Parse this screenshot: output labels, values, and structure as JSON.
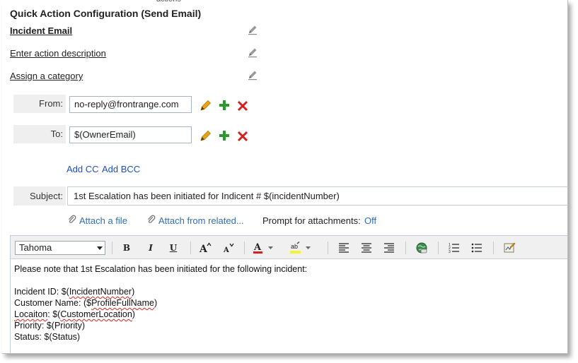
{
  "clipped_text": "actions",
  "title": "Quick Action Configuration (Send Email)",
  "action_name": "Incident Email",
  "action_description": "Enter action description",
  "action_category": "Assign a category",
  "from": {
    "label": "From:",
    "value": "no-reply@frontrange.com"
  },
  "to": {
    "label": "To:",
    "value": "$(OwnerEmail)"
  },
  "add_cc": "Add CC",
  "add_bcc": "Add BCC",
  "subject": {
    "label": "Subject:",
    "value": "1st Escalation has been initiated for Indicent # $(incidentNumber)"
  },
  "attach_file": "Attach a file",
  "attach_related": "Attach from related...",
  "prompt_label": "Prompt for attachments:",
  "prompt_value": "Off",
  "editor": {
    "font": "Tahoma",
    "lines": {
      "intro": "Please note that 1st Escalation has been initiated for the following incident:",
      "incident_prefix": "Incident ID: $(",
      "incident_var": "IncidentNumber",
      "incident_suffix": ")",
      "customer_prefix": "Customer Name: ($",
      "customer_var": "ProfileFullName",
      "customer_suffix": ")",
      "location_word": "Locaiton",
      "location_prefix": ": $(",
      "location_var": "CustomerLocation",
      "location_suffix": ")",
      "priority": "Priority: $(Priority)",
      "status": "Status: $(Status)"
    }
  },
  "colors": {
    "link_blue": "#1f4fbf",
    "edit_pencil": "#e8a317",
    "add_green": "#2a9a2a",
    "delete_red": "#d21f1f"
  }
}
